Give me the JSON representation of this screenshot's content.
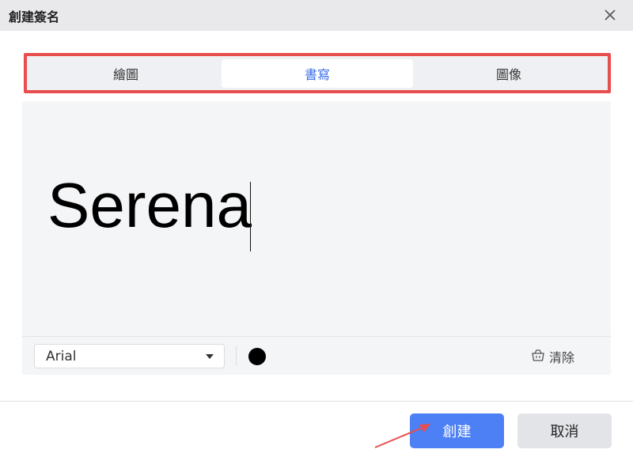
{
  "dialog": {
    "title": "創建簽名"
  },
  "tabs": [
    {
      "label": "繪圖",
      "active": false
    },
    {
      "label": "書寫",
      "active": true
    },
    {
      "label": "圖像",
      "active": false
    }
  ],
  "signature": {
    "text": "Serena"
  },
  "toolbar": {
    "font_value": "Arial",
    "ink_color": "#000000",
    "clear_label": "清除"
  },
  "footer": {
    "create_label": "創建",
    "cancel_label": "取消"
  },
  "colors": {
    "accent": "#4d80f4",
    "active_tab_text": "#3b6ee8",
    "highlight_border": "#e84e4e",
    "annotation_arrow": "#e84e4e"
  },
  "icons": [
    "close-icon",
    "dropdown-arrow-icon",
    "trash-icon",
    "annotation-arrow"
  ]
}
